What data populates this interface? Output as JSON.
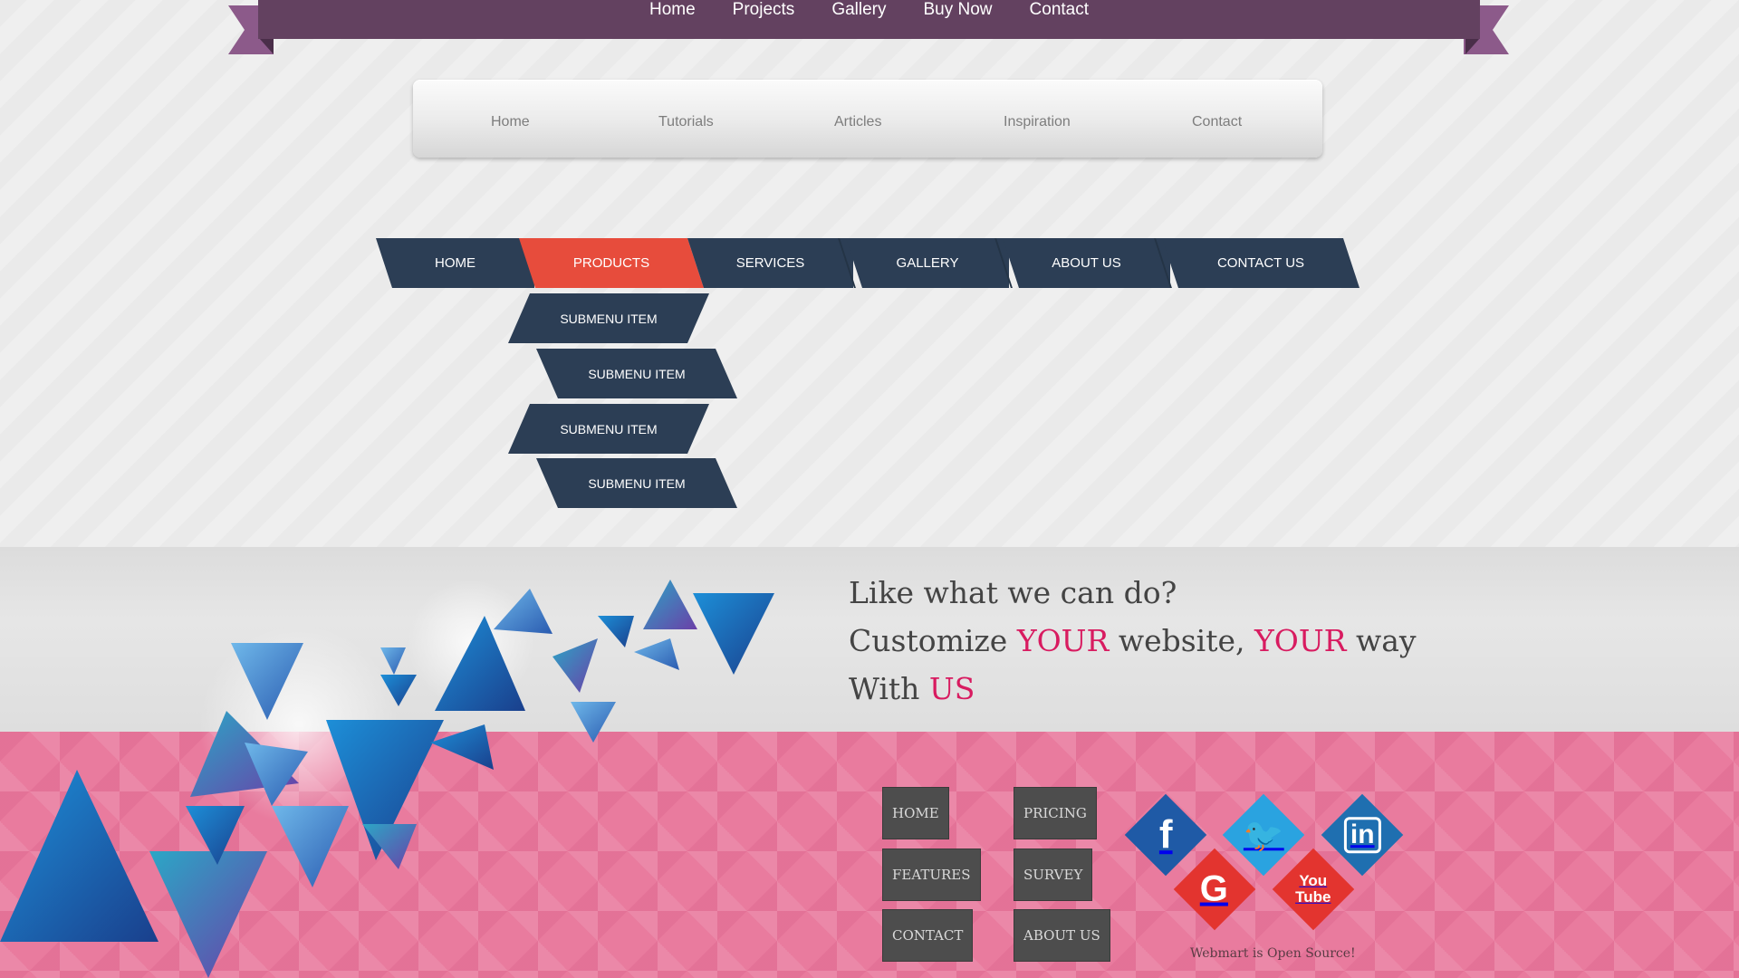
{
  "ribbon_nav": {
    "items": [
      "Home",
      "Projects",
      "Gallery",
      "Buy Now",
      "Contact"
    ]
  },
  "gloss_nav": {
    "items": [
      "Home",
      "Tutorials",
      "Articles",
      "Inspiration",
      "Contact"
    ]
  },
  "slant_nav": {
    "items": [
      "HOME",
      "PRODUCTS",
      "SERVICES",
      "GALLERY",
      "ABOUT US",
      "CONTACT US"
    ],
    "active": "PRODUCTS",
    "submenu": [
      "SUBMENU ITEM",
      "SUBMENU ITEM",
      "SUBMENU ITEM",
      "SUBMENU ITEM"
    ]
  },
  "banner": {
    "line1": "Like what we can do?",
    "line2_a": "Customize ",
    "line2_b": "YOUR",
    "line2_c": " website, ",
    "line2_d": "YOUR",
    "line2_e": " way",
    "line3_a": "With ",
    "line3_b": "US"
  },
  "footer": {
    "links": [
      "HOME",
      "PRICING",
      "FEATURES",
      "SURVEY",
      "CONTACT",
      "ABOUT US"
    ],
    "social": [
      {
        "name": "facebook-icon",
        "glyph": "f",
        "color": "#1f5aa6"
      },
      {
        "name": "twitter-icon",
        "glyph": "🐦",
        "color": "#2aa3e0"
      },
      {
        "name": "linkedin-icon",
        "glyph": "in",
        "color": "#1f6fb0"
      },
      {
        "name": "google-icon",
        "glyph": "G",
        "color": "#e3342f"
      },
      {
        "name": "youtube-icon",
        "glyph": "You Tube",
        "color": "#e3342f"
      }
    ],
    "tagline": "Webmart is Open Source!"
  },
  "colors": {
    "ribbon": "#634160",
    "slant": "#2c3e55",
    "active": "#e74c3c",
    "accent": "#d81b60",
    "footer": "#e97b9e"
  }
}
